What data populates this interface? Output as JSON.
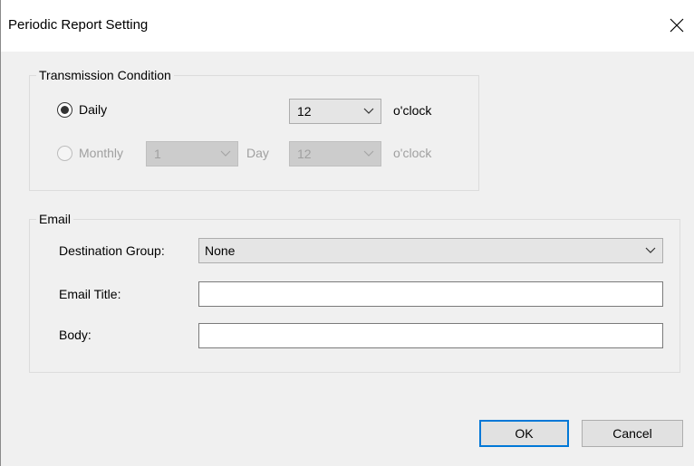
{
  "window": {
    "title": "Periodic Report Setting"
  },
  "transmission": {
    "legend": "Transmission Condition",
    "daily": {
      "label": "Daily",
      "hour": "12",
      "suffix": "o'clock"
    },
    "monthly": {
      "label": "Monthly",
      "day": "1",
      "day_label": "Day",
      "hour": "12",
      "suffix": "o'clock"
    }
  },
  "email": {
    "legend": "Email",
    "destination_label": "Destination Group:",
    "destination_value": "None",
    "title_label": "Email Title:",
    "title_value": "",
    "body_label": "Body:",
    "body_value": ""
  },
  "buttons": {
    "ok": "OK",
    "cancel": "Cancel"
  },
  "colors": {
    "accent": "#0078d7",
    "dialog_bg": "#f0f0f0",
    "disabled_text": "#a0a0a0"
  }
}
